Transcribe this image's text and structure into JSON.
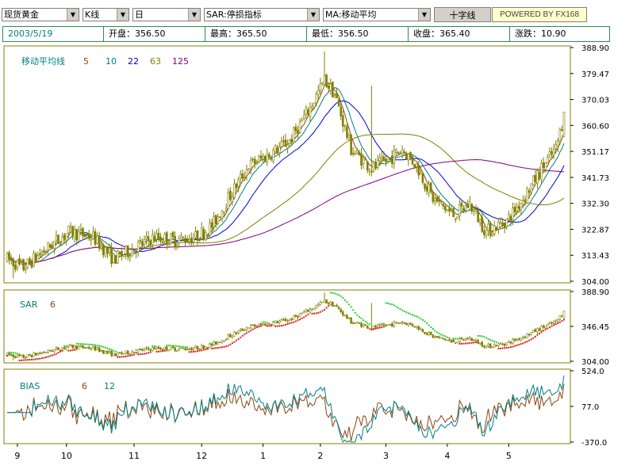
{
  "toolbar": {
    "symbol": "现货黄金",
    "chart_type": "K线",
    "period": "日",
    "indicator": "SAR:停损指标",
    "overlay": "MA:移动平均",
    "crosshair_button": "十字线",
    "powered": "POWERED BY FX168"
  },
  "info": {
    "date": "2003/5/19",
    "open": "开盘：356.50",
    "high": "最高：365.50",
    "low": "最低：356.50",
    "close": "收盘：365.40",
    "change": "涨跌：10.90"
  },
  "colors": {
    "ma5": "#8b4513",
    "ma10": "#008080",
    "ma22": "#0000cd",
    "ma63": "#808000",
    "ma125": "#800080",
    "candle": "#808000",
    "sar_up": "#33cc33",
    "sar_down": "#dd2222",
    "bias6": "#8b4513",
    "bias12": "#008080",
    "frame": "#808000",
    "axis": "#000000"
  },
  "chart_data": [
    {
      "type": "candlestick",
      "legend": {
        "title": "移动平均线",
        "periods": [
          "5",
          "10",
          "22",
          "63",
          "125"
        ]
      },
      "ylim": [
        304.0,
        388.9
      ],
      "yticks": [
        "388.90",
        "379.47",
        "370.03",
        "360.60",
        "351.17",
        "341.73",
        "332.30",
        "322.87",
        "313.43",
        "304.00"
      ],
      "xticks": [
        "9",
        "10",
        "11",
        "12",
        "1",
        "2",
        "3",
        "4",
        "5"
      ],
      "anchors": [
        [
          0,
          312
        ],
        [
          8,
          309
        ],
        [
          18,
          315
        ],
        [
          30,
          322
        ],
        [
          42,
          320
        ],
        [
          52,
          312
        ],
        [
          62,
          316
        ],
        [
          72,
          320
        ],
        [
          82,
          319
        ],
        [
          92,
          320
        ],
        [
          100,
          324
        ],
        [
          108,
          334
        ],
        [
          118,
          346
        ],
        [
          128,
          350
        ],
        [
          138,
          355
        ],
        [
          148,
          367
        ],
        [
          155,
          377
        ],
        [
          160,
          372
        ],
        [
          168,
          352
        ],
        [
          178,
          345
        ],
        [
          186,
          348
        ],
        [
          193,
          352
        ],
        [
          200,
          346
        ],
        [
          208,
          334
        ],
        [
          218,
          328
        ],
        [
          226,
          332
        ],
        [
          234,
          322
        ],
        [
          244,
          326
        ],
        [
          252,
          334
        ],
        [
          262,
          346
        ],
        [
          268,
          352
        ],
        [
          272,
          364
        ]
      ],
      "last": {
        "open": 356.5,
        "high": 365.5,
        "low": 356.5,
        "close": 365.4
      }
    },
    {
      "type": "sar",
      "legend": {
        "title": "SAR",
        "periods": [
          "6"
        ]
      },
      "yticks": [
        "388.90",
        "346.45",
        "304.00"
      ]
    },
    {
      "type": "line",
      "legend": {
        "title": "BIAS",
        "periods": [
          "6",
          "12"
        ]
      },
      "yticks": [
        "524.0",
        "77.0",
        "-370.0"
      ]
    }
  ]
}
